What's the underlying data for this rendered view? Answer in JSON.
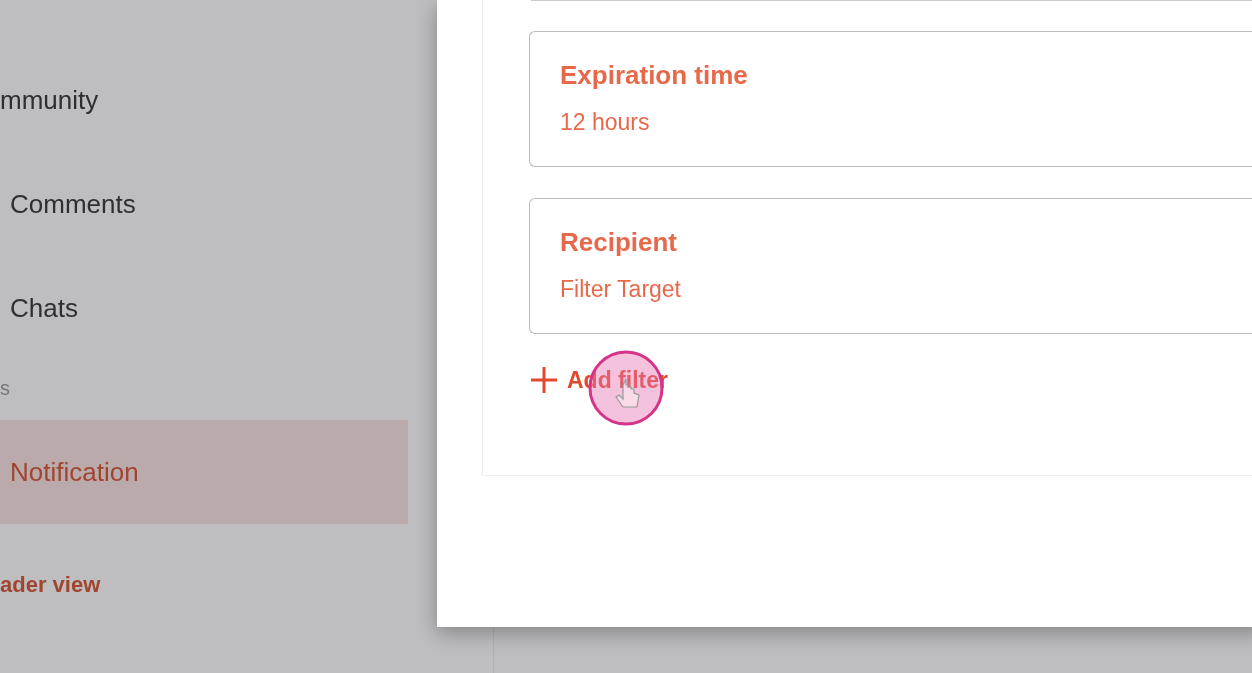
{
  "sidebar": {
    "items": [
      {
        "label": "mmunity",
        "kind": "item",
        "selected": false
      },
      {
        "label": "Comments",
        "kind": "subitem",
        "selected": false
      },
      {
        "label": "Chats",
        "kind": "subitem",
        "selected": false
      },
      {
        "label": "s",
        "kind": "section"
      },
      {
        "label": "Notification",
        "kind": "subitem",
        "selected": true
      },
      {
        "label": "ader view",
        "kind": "link"
      }
    ]
  },
  "dialog": {
    "filters": [
      {
        "title": "Expiration time",
        "value": "12 hours"
      },
      {
        "title": "Recipient",
        "value": "Filter Target"
      }
    ],
    "add_button": "Add filter"
  }
}
